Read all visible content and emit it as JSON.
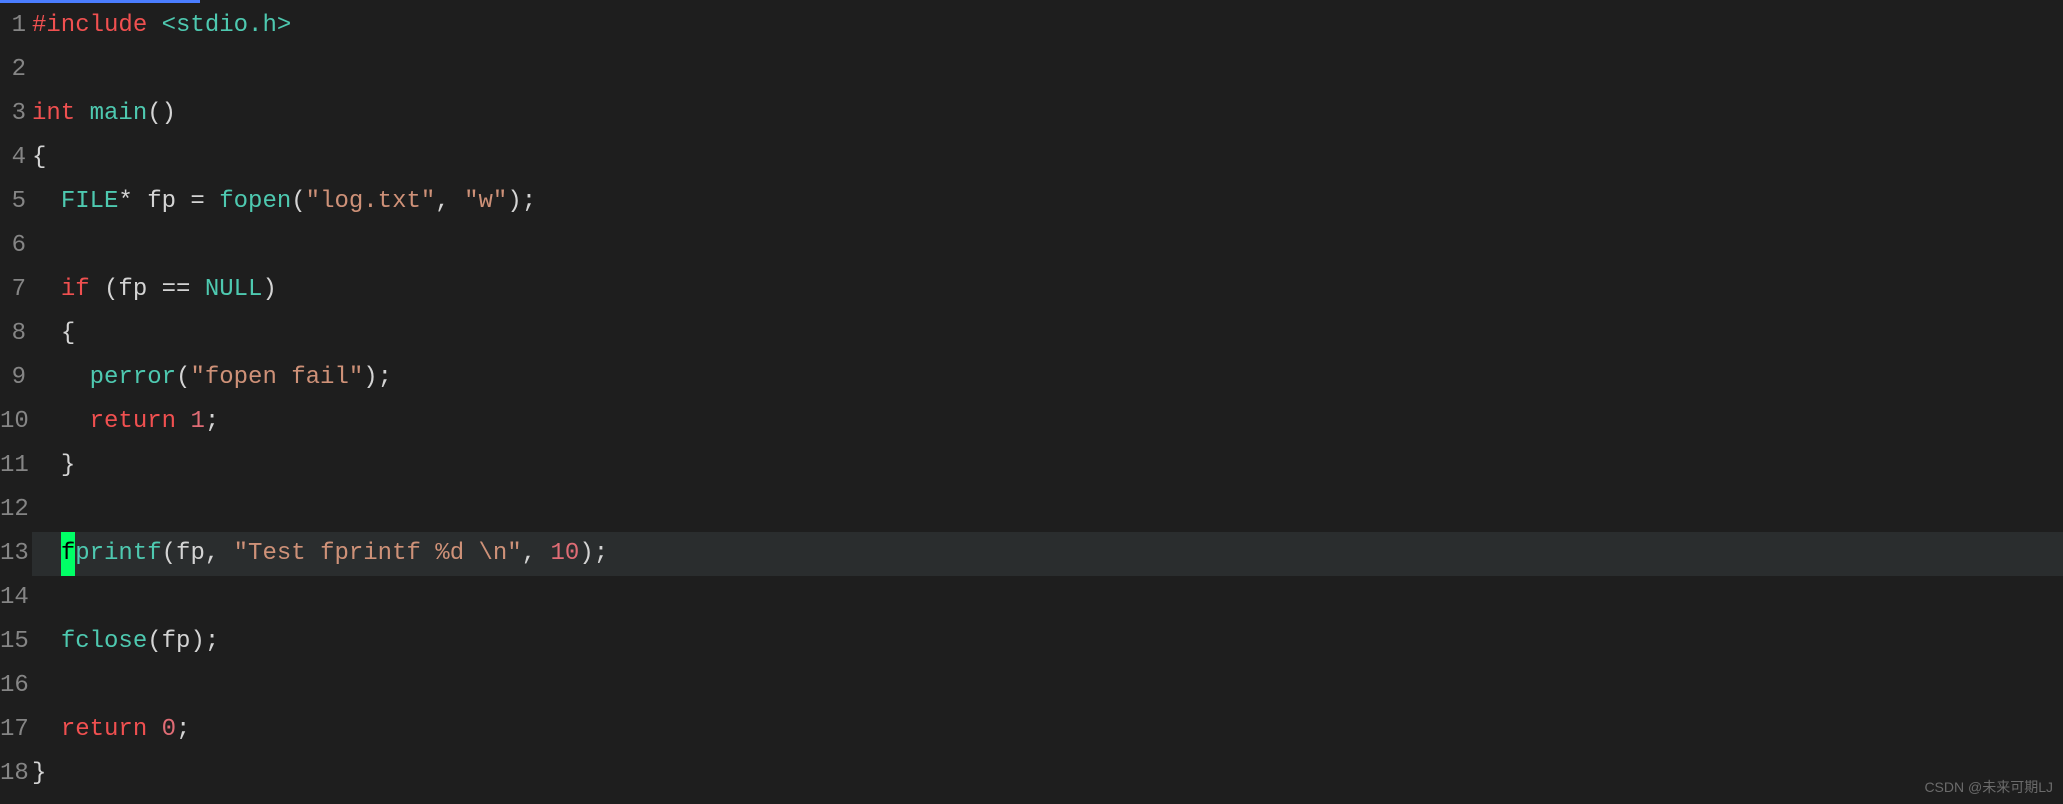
{
  "watermark": "CSDN @未来可期LJ",
  "cursorLine": 13,
  "lineNumbers": [
    "1",
    "2",
    "3",
    "4",
    "5",
    "6",
    "7",
    "8",
    "9",
    "10",
    "11",
    "12",
    "13",
    "14",
    "15",
    "16",
    "17",
    "18"
  ],
  "code": {
    "l1": {
      "t1": "#include",
      "t2": " ",
      "t3": "<stdio.h>"
    },
    "l2": "",
    "l3": {
      "t1": "int",
      "t2": " ",
      "t3": "main",
      "t4": "()"
    },
    "l4": "{",
    "l5": {
      "indent": "  ",
      "t1": "FILE",
      "t2": "* fp = ",
      "t3": "fopen",
      "t4": "(",
      "t5": "\"log.txt\"",
      "t6": ", ",
      "t7": "\"w\"",
      "t8": ");"
    },
    "l6": "",
    "l7": {
      "indent": "  ",
      "t1": "if",
      "t2": " (fp == ",
      "t3": "NULL",
      "t4": ")"
    },
    "l8": {
      "indent": "  ",
      "t1": "{"
    },
    "l9": {
      "indent": "    ",
      "t1": "perror",
      "t2": "(",
      "t3": "\"fopen fail\"",
      "t4": ");"
    },
    "l10": {
      "indent": "    ",
      "t1": "return",
      "t2": " ",
      "t3": "1",
      "t4": ";"
    },
    "l11": {
      "indent": "  ",
      "t1": "}"
    },
    "l12": "",
    "l13": {
      "indent": "  ",
      "cursor": "f",
      "t1": "printf",
      "t2": "(fp, ",
      "t3": "\"Test fprintf %d \\n\"",
      "t4": ", ",
      "t5": "10",
      "t6": ");"
    },
    "l14": "",
    "l15": {
      "indent": "  ",
      "t1": "fclose",
      "t2": "(fp);"
    },
    "l16": "",
    "l17": {
      "indent": "  ",
      "t1": "return",
      "t2": " ",
      "t3": "0",
      "t4": ";"
    },
    "l18": "}"
  }
}
